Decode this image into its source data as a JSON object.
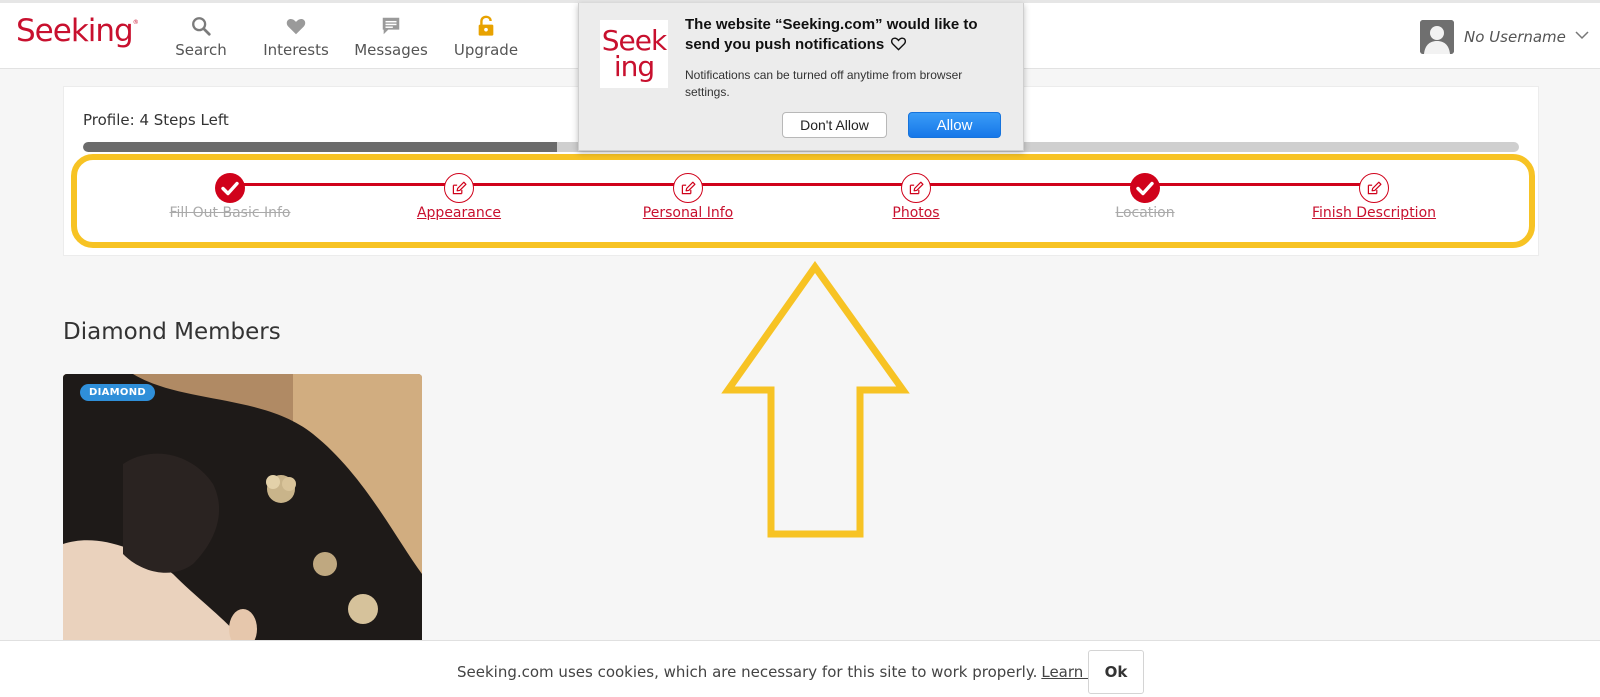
{
  "header": {
    "logo_text": "Seeking",
    "logo_mark": "®",
    "nav": [
      {
        "label": "Search",
        "icon": "search-icon"
      },
      {
        "label": "Interests",
        "icon": "heart-icon"
      },
      {
        "label": "Messages",
        "icon": "chat-icon"
      },
      {
        "label": "Upgrade",
        "icon": "unlock-icon"
      }
    ],
    "username": "No Username"
  },
  "push_popup": {
    "logo_line1": "Seek",
    "logo_line2": "ing",
    "title": "The website “Seeking.com” would like to send you push notifications",
    "body": "Notifications can be turned off anytime from browser settings.",
    "dont_allow_label": "Don't Allow",
    "allow_label": "Allow"
  },
  "profile": {
    "steps_left_label": "Profile: 4 Steps Left",
    "progress_fraction": 0.33,
    "steps": [
      {
        "label": "Fill Out Basic Info",
        "status": "done"
      },
      {
        "label": "Appearance",
        "status": "todo"
      },
      {
        "label": "Personal Info",
        "status": "todo"
      },
      {
        "label": "Photos",
        "status": "todo"
      },
      {
        "label": "Location",
        "status": "done"
      },
      {
        "label": "Finish Description",
        "status": "todo"
      }
    ]
  },
  "diamond": {
    "title": "Diamond Members",
    "badge": "DIAMOND"
  },
  "cookie": {
    "text": "Seeking.com uses cookies, which are necessary for this site to work properly.",
    "link": "Learn more",
    "ok_label": "Ok"
  },
  "colors": {
    "brand": "#c8102e",
    "step_line": "#d0021b",
    "highlight": "#f7c324",
    "allow_button": "#1677e8",
    "badge": "#2f8fd9"
  }
}
